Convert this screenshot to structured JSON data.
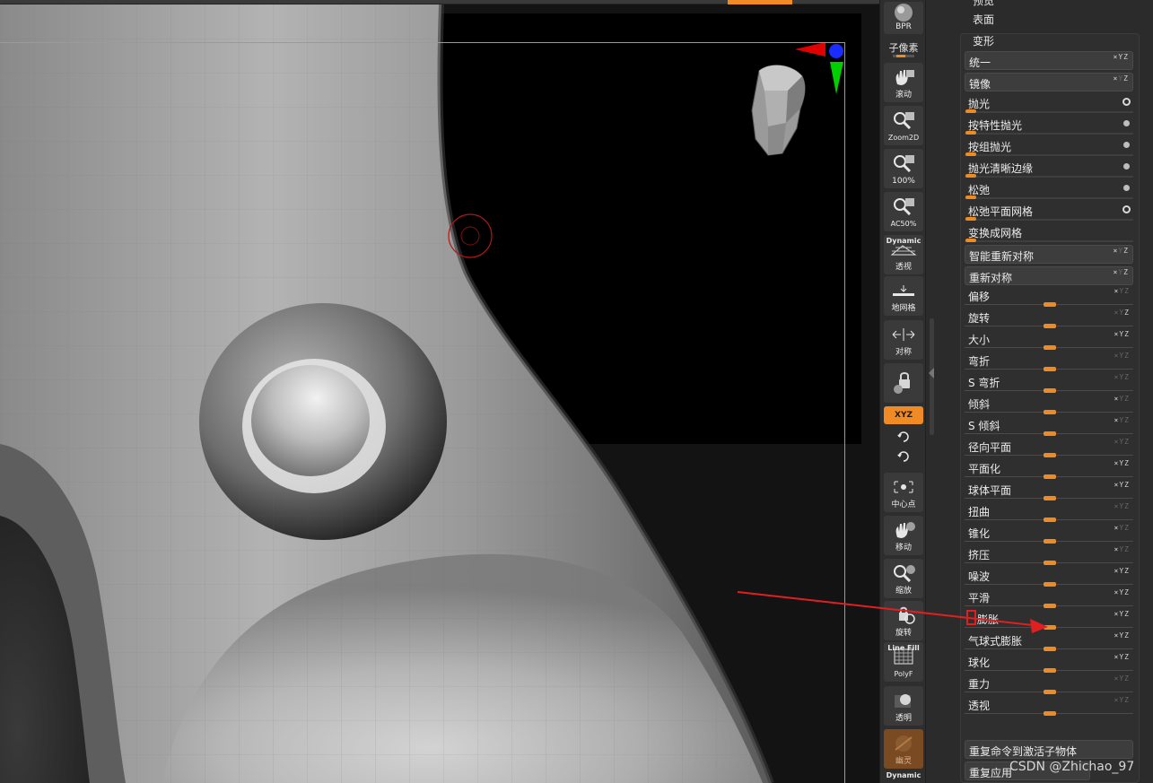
{
  "toolbar": {
    "bpr_label": "BPR",
    "subpixel_label": "子像素",
    "tools": [
      {
        "id": "scroll",
        "label": "滚动"
      },
      {
        "id": "zoom2d",
        "label": "Zoom2D"
      },
      {
        "id": "actual",
        "label": "100%"
      },
      {
        "id": "ac50",
        "label": "AC50%"
      },
      {
        "id": "perspective",
        "top_label": "Dynamic",
        "label": "透视"
      },
      {
        "id": "floor",
        "label": "地网格"
      },
      {
        "id": "symmetry",
        "label": "对称"
      },
      {
        "id": "lock",
        "label": ""
      },
      {
        "id": "xyz",
        "label": "XYZ"
      },
      {
        "id": "center",
        "label": "中心点"
      },
      {
        "id": "move",
        "label": "移动"
      },
      {
        "id": "scale",
        "label": "缩放"
      },
      {
        "id": "rotate",
        "label": "旋转"
      },
      {
        "id": "polyf",
        "top_label": "Line Fill",
        "label": "PolyF"
      },
      {
        "id": "transp",
        "label": "透明"
      },
      {
        "id": "ghost",
        "label": "幽灵"
      }
    ],
    "bottom_label": "Dynamic"
  },
  "panel": {
    "headings": [
      "预览",
      "表面",
      "变形"
    ],
    "rows": [
      {
        "label": "统一",
        "kind": "button",
        "axes": "xyz"
      },
      {
        "label": "镜像",
        "kind": "button",
        "axes": "xyz-dim"
      },
      {
        "label": "抛光",
        "kind": "toggle",
        "dot": "ring"
      },
      {
        "label": "按特性抛光",
        "kind": "toggle",
        "dot": "dot"
      },
      {
        "label": "按组抛光",
        "kind": "toggle",
        "dot": "dot"
      },
      {
        "label": "抛光清晰边缘",
        "kind": "toggle",
        "dot": "dot"
      },
      {
        "label": "松弛",
        "kind": "toggle",
        "dot": "dot"
      },
      {
        "label": "松弛平面网格",
        "kind": "toggle",
        "dot": "ring"
      },
      {
        "label": "变换成网格",
        "kind": "toggle",
        "dot": "none"
      },
      {
        "label": "智能重新对称",
        "kind": "button",
        "axes": "xyz-dim"
      },
      {
        "label": "重新对称",
        "kind": "button",
        "axes": "xyz-dim"
      },
      {
        "label": "偏移",
        "kind": "slider",
        "axes": "x"
      },
      {
        "label": "旋转",
        "kind": "slider",
        "axes": "z"
      },
      {
        "label": "大小",
        "kind": "slider",
        "axes": "xyz"
      },
      {
        "label": "弯折",
        "kind": "slider",
        "axes": "dim"
      },
      {
        "label": "S 弯折",
        "kind": "slider",
        "axes": "dim"
      },
      {
        "label": "倾斜",
        "kind": "slider",
        "axes": "x"
      },
      {
        "label": "S 倾斜",
        "kind": "slider",
        "axes": "x"
      },
      {
        "label": "径向平面",
        "kind": "slider",
        "axes": "dim"
      },
      {
        "label": "平面化",
        "kind": "slider",
        "axes": "xyz"
      },
      {
        "label": "球体平面",
        "kind": "slider",
        "axes": "xyz"
      },
      {
        "label": "扭曲",
        "kind": "slider",
        "axes": "dim"
      },
      {
        "label": "锥化",
        "kind": "slider",
        "axes": "x"
      },
      {
        "label": "挤压",
        "kind": "slider",
        "axes": "x"
      },
      {
        "label": "噪波",
        "kind": "slider",
        "axes": "xyz"
      },
      {
        "label": "平滑",
        "kind": "slider",
        "axes": "xyz"
      },
      {
        "label": "膨胀",
        "kind": "slider",
        "axes": "xyz",
        "highlight": true
      },
      {
        "label": "气球式膨胀",
        "kind": "slider",
        "axes": "xyz"
      },
      {
        "label": "球化",
        "kind": "slider",
        "axes": "xyz"
      },
      {
        "label": "重力",
        "kind": "slider",
        "axes": "dim"
      },
      {
        "label": "透视",
        "kind": "slider",
        "axes": "dim"
      }
    ],
    "footer": [
      {
        "label": "重复命令到激活子物体"
      },
      {
        "label": "重复应用"
      }
    ]
  },
  "watermark": "CSDN @Zhichao_97",
  "colors": {
    "accent": "#f08a24",
    "annotation_arrow": "#e02020",
    "viewport_bg": "#141414"
  }
}
